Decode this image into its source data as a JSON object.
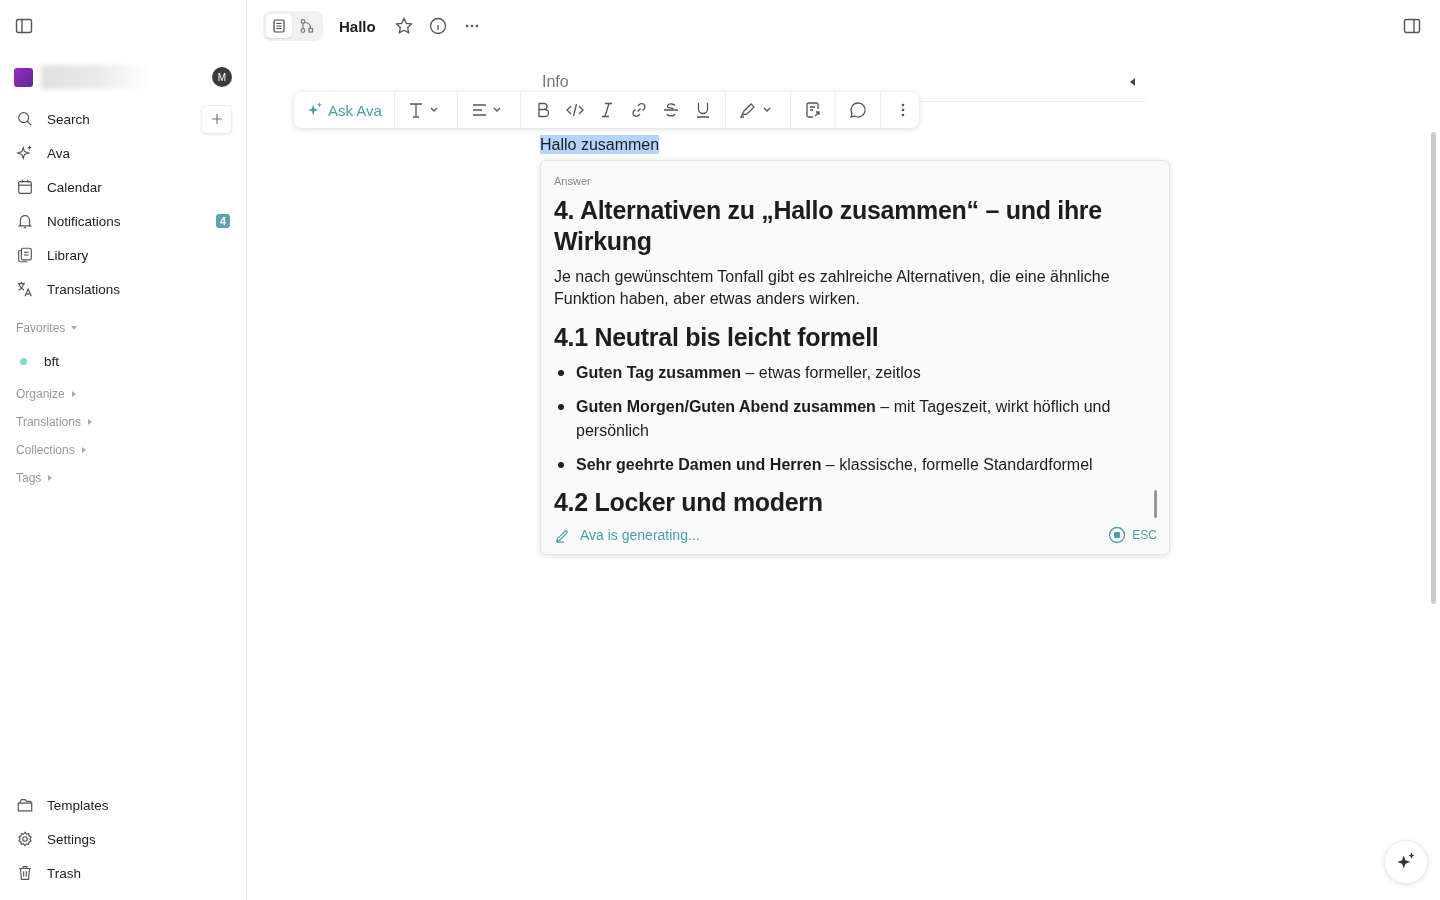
{
  "sidebar": {
    "avatar_initial": "M",
    "nav": [
      {
        "label": "Search"
      },
      {
        "label": "Ava"
      },
      {
        "label": "Calendar"
      },
      {
        "label": "Notifications",
        "badge": "4"
      },
      {
        "label": "Library"
      },
      {
        "label": "Translations"
      }
    ],
    "sections": [
      {
        "label": "Favorites",
        "expanded": true,
        "items": [
          {
            "label": "bft",
            "color": "#7ddfd3"
          }
        ]
      },
      {
        "label": "Organize",
        "expanded": false
      },
      {
        "label": "Translations",
        "expanded": false
      },
      {
        "label": "Collections",
        "expanded": false
      },
      {
        "label": "Tags",
        "expanded": false
      }
    ],
    "bottom": [
      {
        "label": "Templates"
      },
      {
        "label": "Settings"
      },
      {
        "label": "Trash"
      }
    ]
  },
  "header": {
    "title": "Hallo",
    "view_tabs": [
      {
        "selected": true
      },
      {
        "selected": false
      }
    ]
  },
  "info": {
    "label": "Info",
    "expanded": false
  },
  "toolbar": {
    "ask_label": "Ask Ava"
  },
  "selected_text": {
    "text": "Hallo zusammen",
    "selected": true
  },
  "answer": {
    "label": "Answer",
    "blocks": [
      {
        "kind": "h",
        "text": "4. Alternativen zu „Hallo zusammen“ – und ihre Wirkung"
      },
      {
        "kind": "p",
        "text": "Je nach gewünschtem Tonfall gibt es zahlreiche Alternativen, die eine ähnliche Funktion haben, aber etwas anders wirken."
      },
      {
        "kind": "h",
        "text": "4.1 Neutral bis leicht formell"
      },
      {
        "kind": "li",
        "text": "**Guten Tag zusammen** – etwas formeller, zeitlos"
      },
      {
        "kind": "li",
        "text": "**Guten Morgen/Guten Abend zusammen** – mit Tageszeit, wirkt höflich und persönlich"
      },
      {
        "kind": "li",
        "text": "**Sehr geehrte Damen und Herren** – klassische, formelle Standardformel"
      },
      {
        "kind": "h",
        "text": "4.2 Locker und modern"
      }
    ],
    "status": "Ava is generating...",
    "stop_key": "ESC"
  }
}
